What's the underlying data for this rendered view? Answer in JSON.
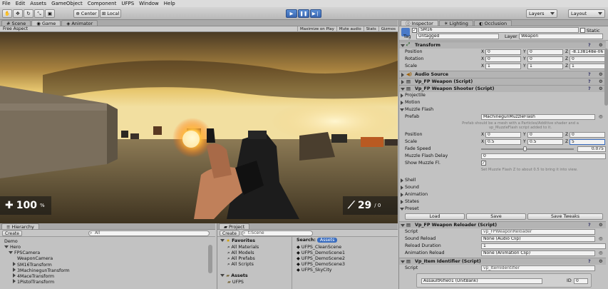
{
  "menu": [
    "File",
    "Edit",
    "Assets",
    "GameObject",
    "Component",
    "UFPS",
    "Window",
    "Help"
  ],
  "toolbar": {
    "center": "Center",
    "local": "Local",
    "layers": "Layers",
    "layout": "Layout"
  },
  "scene_tabs": {
    "scene": "Scene",
    "game": "Game",
    "animator": "Animator"
  },
  "game_bar": {
    "aspect": "Free Aspect",
    "maximize": "Maximize on Play",
    "mute": "Mute audio",
    "stats": "Stats",
    "gizmos": "Gizmos"
  },
  "hud": {
    "health": "100",
    "health_unit": "%",
    "ammo": "29",
    "ammo_total": "/ 0"
  },
  "inspector_tabs": {
    "inspector": "Inspector",
    "lighting": "Lighting",
    "occlusion": "Occlusion"
  },
  "object": {
    "name": "SM16",
    "static": "Static",
    "tag_label": "Tag",
    "tag": "Untagged",
    "layer_label": "Layer",
    "layer": "Weapon"
  },
  "transform": {
    "title": "Transform",
    "position_label": "Position",
    "rotation_label": "Rotation",
    "scale_label": "Scale",
    "position": [
      "0",
      "0",
      "-8.138148e-06"
    ],
    "rotation": [
      "0",
      "0",
      "0"
    ],
    "scale": [
      "1",
      "1",
      "1"
    ]
  },
  "components": {
    "audio": "Audio Source",
    "weapon": "Vp_FP Weapon (Script)",
    "shooter": "Vp_FP Weapon Shooter (Script)",
    "reloader": "Vp_FP Weapon Reloader (Script)",
    "identifier": "Vp_Item Identifier (Script)"
  },
  "shooter": {
    "projectile": "Projectile",
    "motion": "Motion",
    "muzzle_flash": "Muzzle Flash",
    "prefab_label": "Prefab",
    "prefab": "MachinegunMuzzleFlash",
    "prefab_hint": "Prefab should be a mesh with a Particles/Additive shader and a vp_MuzzleFlash script added to it.",
    "position_label": "Position",
    "position": [
      "0",
      "0",
      "0"
    ],
    "scale_label": "Scale",
    "scale": [
      "0.5",
      "0.5",
      "5"
    ],
    "fade_label": "Fade Speed",
    "fade_value": "0.075",
    "fade_level": 0.47,
    "delay_label": "Muzzle Flash Delay",
    "delay_value": "0",
    "show_label": "Show Muzzle Fl.",
    "show_hint": "Set Muzzle Flash Z to about 0.5 to bring it into view.",
    "shell": "Shell",
    "sound": "Sound",
    "animation": "Animation",
    "states": "States",
    "preset": "Preset",
    "load": "Load",
    "save": "Save",
    "save_tweaks": "Save Tweaks"
  },
  "reloader": {
    "script_label": "Script",
    "script": "vp_FPWeaponReloader",
    "sound_label": "Sound Reload",
    "sound": "None (Audio Clip)",
    "duration_label": "Reload Duration",
    "duration": "1",
    "anim_label": "Animation Reload",
    "anim": "None (Animation Clip)"
  },
  "identifier": {
    "script_label": "Script",
    "script": "vp_ItemIdentifier",
    "asset": "AssaultRifle01 (UnitBank)",
    "id_label": "ID",
    "id": "0"
  },
  "hierarchy": {
    "tab": "Hierarchy",
    "create": "Create",
    "search": "All",
    "items": [
      "Demo",
      "Hero",
      "FPSCamera",
      "WeaponCamera",
      "SM16Transform",
      "3MachinegunTransform",
      "4MaceTransform",
      "1PistolTransform"
    ]
  },
  "project": {
    "tab": "Project",
    "create": "Create",
    "search": "t:Scene",
    "search_label": "Search:",
    "search_scope": "Assets",
    "favorites": "Favorites",
    "fav_items": [
      "All Materials",
      "All Models",
      "All Prefabs",
      "All Scripts"
    ],
    "assets": "Assets",
    "asset_items": [
      "UFPS"
    ],
    "scenes": [
      "UFPS_CleanScene",
      "UFPS_DemoScene1",
      "UFPS_DemoScene2",
      "UFPS_DemoScene3",
      "UFPS_SkyCity"
    ]
  },
  "colors": {
    "accent": "#3a6dbf",
    "panel": "#c2c2c2",
    "header": "#b4b4b4"
  }
}
